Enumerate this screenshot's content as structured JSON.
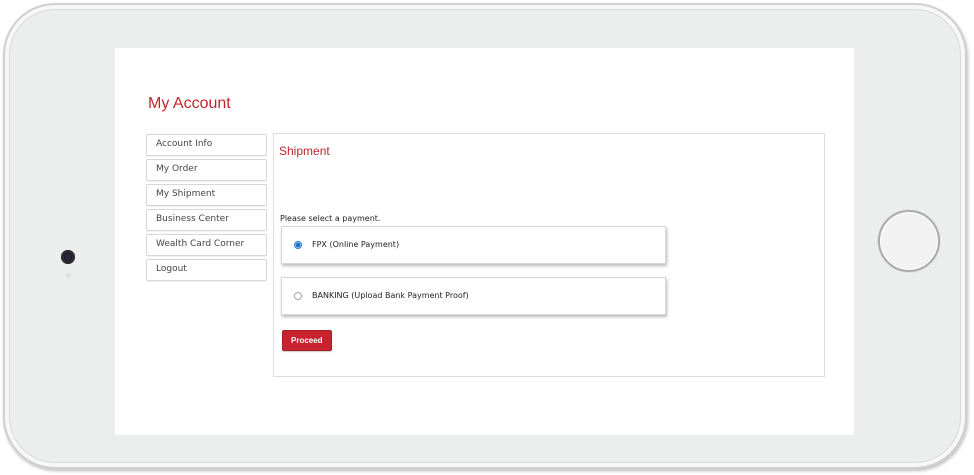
{
  "account": {
    "title": "My Account"
  },
  "side_menu": {
    "items": [
      {
        "label": "Account Info"
      },
      {
        "label": "My Order"
      },
      {
        "label": "My Shipment"
      },
      {
        "label": "Business Center"
      },
      {
        "label": "Wealth Card Corner"
      },
      {
        "label": "Logout"
      }
    ]
  },
  "shipment": {
    "title": "Shipment",
    "select_prompt": "Please select a payment.",
    "options": [
      {
        "label": "FPX (Online Payment)",
        "selected": true
      },
      {
        "label": "BANKING (Upload Bank Payment Proof)",
        "selected": false
      }
    ],
    "proceed_label": "Proceed"
  },
  "colors": {
    "accent": "#c0272d",
    "button": "#c8222e",
    "device_frame": "#eceded"
  },
  "icons": {
    "camera": "front-camera-icon",
    "home": "home-button-icon"
  }
}
